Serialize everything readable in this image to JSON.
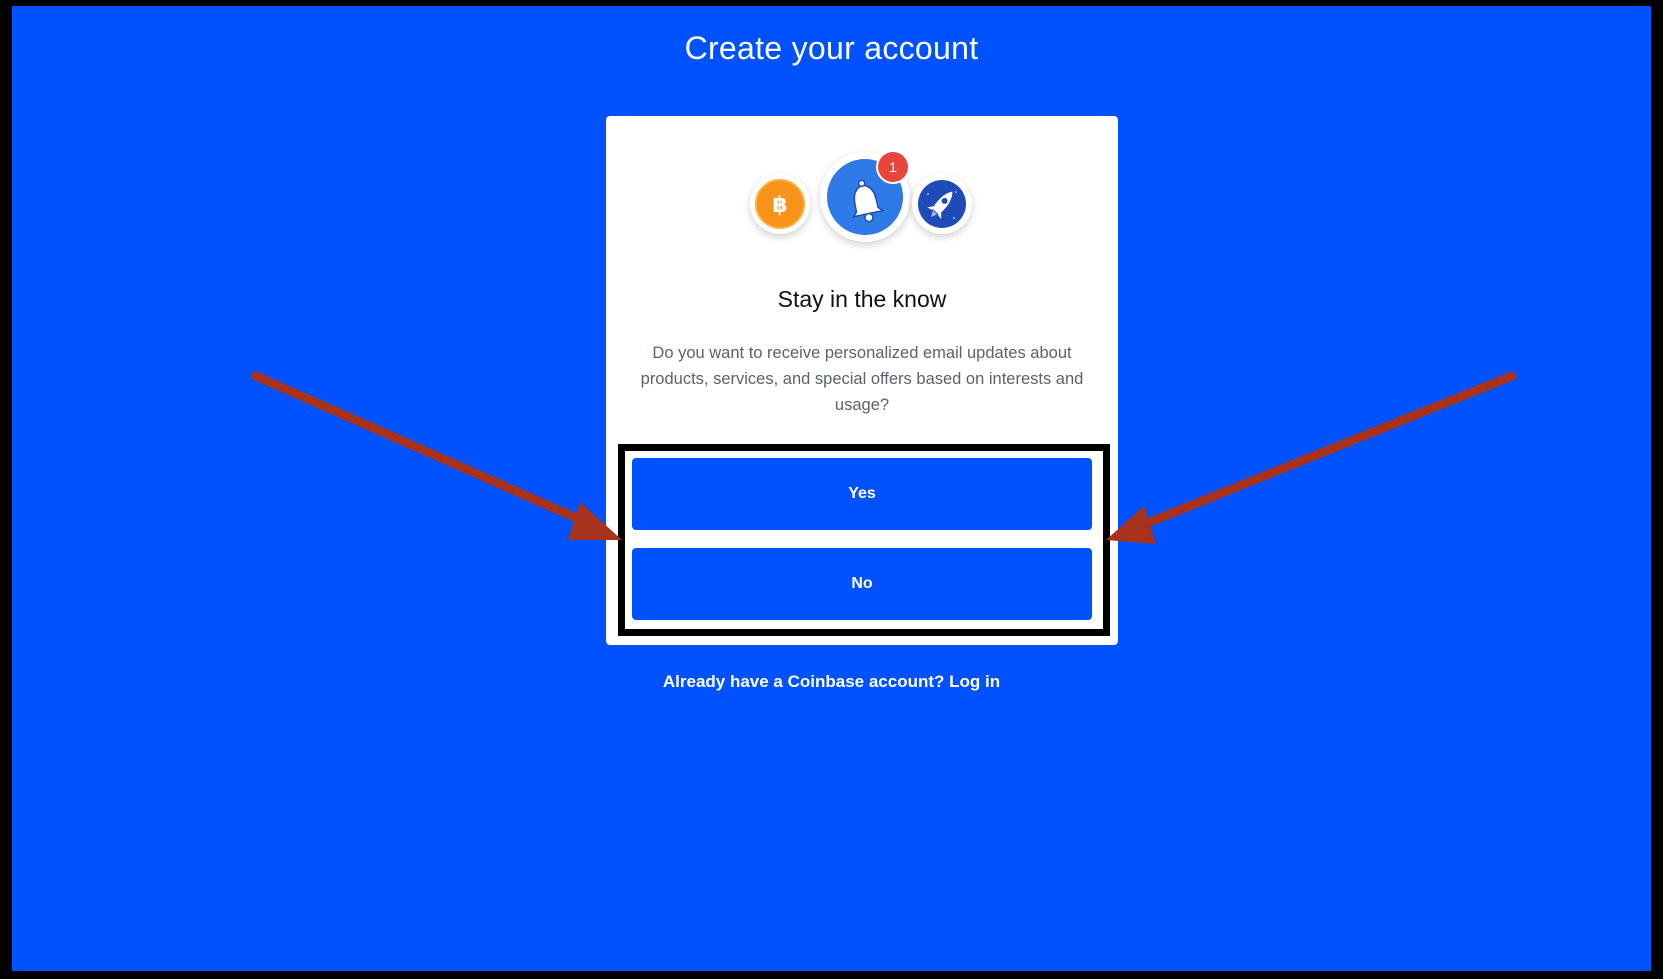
{
  "page": {
    "title": "Create your account"
  },
  "card": {
    "badge_count": "1",
    "heading": "Stay in the know",
    "description": "Do you want to receive personalized email updates about products, services, and special offers based on interests and usage?",
    "icons": [
      "bitcoin-icon",
      "bell-icon",
      "rocket-icon"
    ]
  },
  "buttons": {
    "yes_label": "Yes",
    "no_label": "No"
  },
  "footer": {
    "login_text": "Already have a Coinbase account? Log in"
  },
  "colors": {
    "background": "#0052ff",
    "button": "#0052ff",
    "badge": "#e8453c",
    "bitcoin": "#f7931a",
    "annotation_arrow": "#a8321c"
  }
}
